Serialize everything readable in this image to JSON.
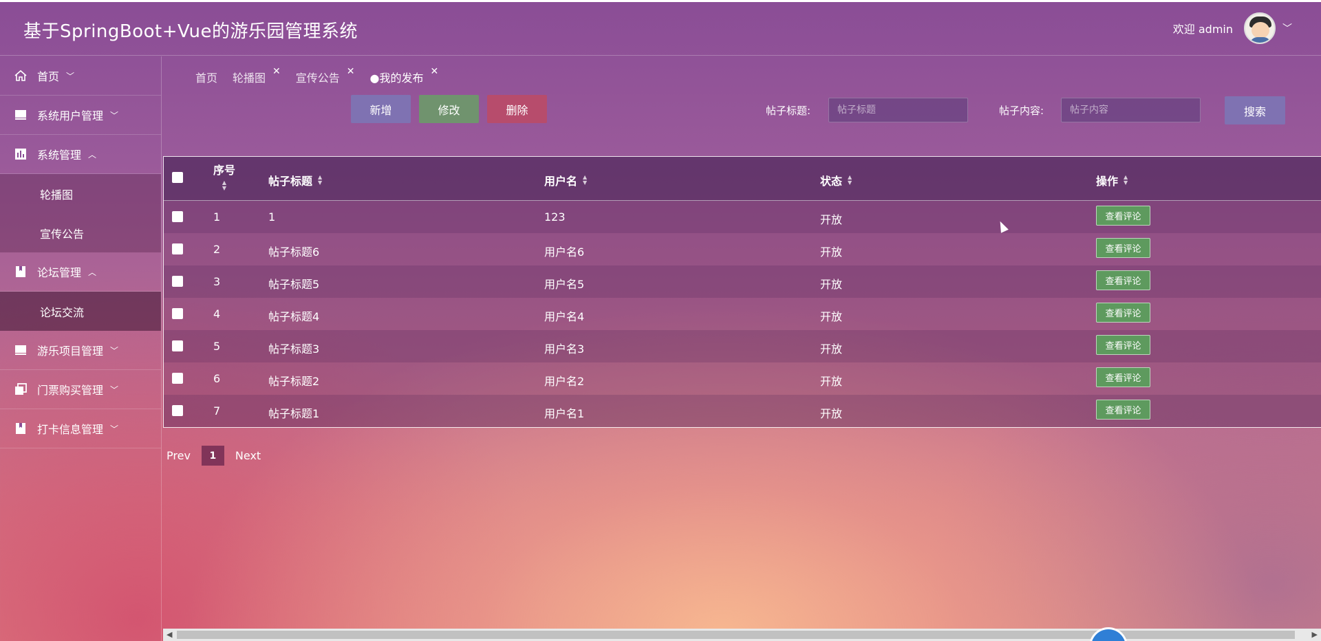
{
  "header": {
    "title": "基于SpringBoot+Vue的游乐园管理系统",
    "welcome": "欢迎 admin",
    "dropdown_icon": "chevron-down-icon"
  },
  "sidebar": {
    "items": [
      {
        "label": "首页",
        "icon": "home-icon",
        "arrow": "﹀"
      },
      {
        "label": "系统用户管理",
        "icon": "monitor-icon",
        "arrow": "﹀"
      },
      {
        "label": "系统管理",
        "icon": "chart-icon",
        "arrow": "︿"
      },
      {
        "label": "轮播图"
      },
      {
        "label": "宣传公告"
      },
      {
        "label": "论坛管理",
        "icon": "book-icon",
        "arrow": "︿"
      },
      {
        "label": "论坛交流"
      },
      {
        "label": "游乐项目管理",
        "icon": "monitor-icon",
        "arrow": "﹀"
      },
      {
        "label": "门票购买管理",
        "icon": "copy-icon",
        "arrow": "﹀"
      },
      {
        "label": "打卡信息管理",
        "icon": "book-icon",
        "arrow": "﹀"
      }
    ]
  },
  "tabs": [
    {
      "label": "首页"
    },
    {
      "label": "轮播图",
      "close": "✕"
    },
    {
      "label": "宣传公告",
      "close": "✕"
    },
    {
      "label": "●我的发布",
      "close": "✕"
    }
  ],
  "toolbar": {
    "add_label": "新增",
    "edit_label": "修改",
    "delete_label": "删除",
    "search_label": "搜索"
  },
  "search": {
    "title_label": "帖子标题:",
    "title_placeholder": "帖子标题",
    "content_label": "帖子内容:",
    "content_placeholder": "帖子内容"
  },
  "table": {
    "headers": [
      "序号",
      "帖子标题",
      "用户名",
      "状态",
      "操作"
    ],
    "action_label": "查看评论",
    "rows": [
      {
        "no": "1",
        "title": "1",
        "user": "123",
        "status": "开放"
      },
      {
        "no": "2",
        "title": "帖子标题6",
        "user": "用户名6",
        "status": "开放"
      },
      {
        "no": "3",
        "title": "帖子标题5",
        "user": "用户名5",
        "status": "开放"
      },
      {
        "no": "4",
        "title": "帖子标题4",
        "user": "用户名4",
        "status": "开放"
      },
      {
        "no": "5",
        "title": "帖子标题3",
        "user": "用户名3",
        "status": "开放"
      },
      {
        "no": "6",
        "title": "帖子标题2",
        "user": "用户名2",
        "status": "开放"
      },
      {
        "no": "7",
        "title": "帖子标题1",
        "user": "用户名1",
        "status": "开放"
      }
    ]
  },
  "pagination": {
    "prev": "Prev",
    "current": "1",
    "next": "Next"
  },
  "colors": {
    "add": "#7f72b2",
    "edit": "#70936e",
    "delete": "#b74c6c",
    "action": "#5e9a5e"
  }
}
